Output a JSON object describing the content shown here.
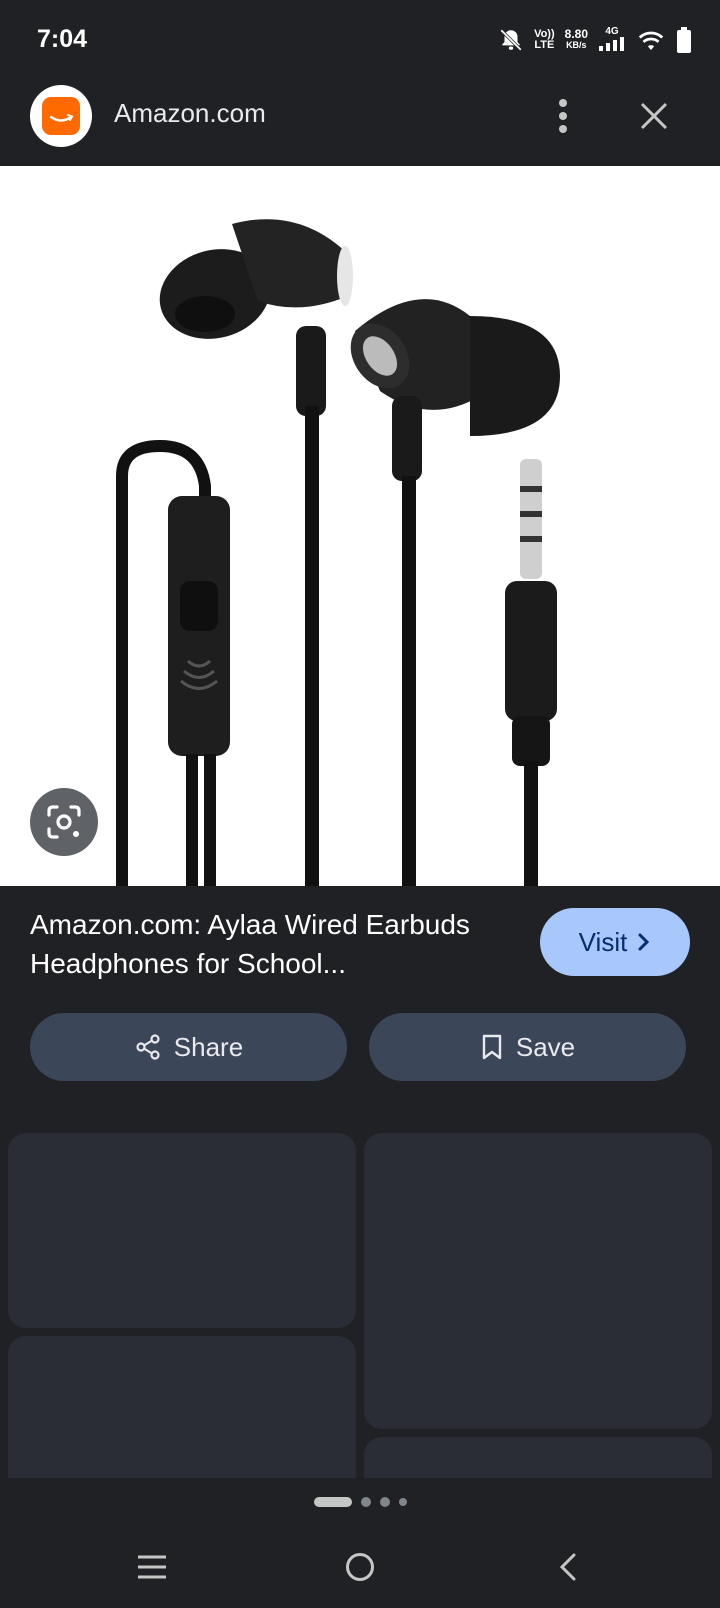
{
  "status_bar": {
    "time": "7:04",
    "volte_top": "Vo))",
    "volte_bottom": "LTE",
    "speed_value": "8.80",
    "speed_unit": "KB/s",
    "network": "4G"
  },
  "header": {
    "site_name": "Amazon.com",
    "icons": [
      "amazon-logo-icon",
      "more-vert-icon",
      "close-icon"
    ]
  },
  "result": {
    "title": "Amazon.com: Aylaa Wired Earbuds Headphones for School...",
    "visit_label": "Visit"
  },
  "actions": {
    "share_label": "Share",
    "save_label": "Save"
  },
  "colors": {
    "background": "#202124",
    "visit_button": "#a8c7fa",
    "action_button": "#3b4659",
    "brand_orange": "#ff6a00"
  },
  "nav": {
    "icons": [
      "recents-icon",
      "home-icon",
      "back-icon"
    ]
  }
}
